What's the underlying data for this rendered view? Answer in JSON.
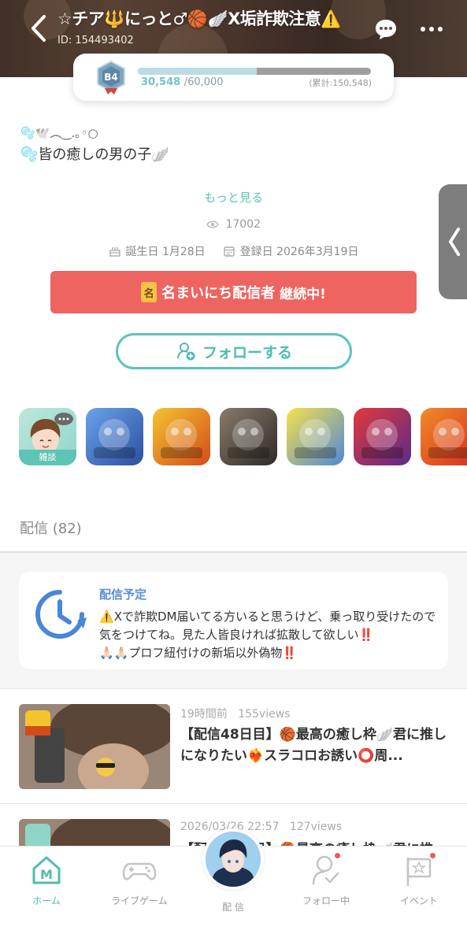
{
  "header": {
    "title": "☆チア🔱にっと♂🏀🪽X垢詐欺注意⚠️",
    "user_id": "ID: 154493402"
  },
  "level": {
    "badge": "B4",
    "current": "30,548",
    "max": "/60,000",
    "total": "(累計:150,548)",
    "progress": 0.509
  },
  "profile": {
    "bio_line1": "🫧🕊️︵‿.｡◦○",
    "bio_line2": "🫧皆の癒しの男の子🪽",
    "more_link": "もっと見る",
    "views": "17002",
    "birthday": "誕生日 1月28日",
    "registered": "登録日 2026年3月19日"
  },
  "streak": {
    "badge": "名",
    "main": "名まいにち配信者",
    "sub": "継続中!"
  },
  "follow_button": "フォローする",
  "games": [
    {
      "name": "chat",
      "label": "雑談",
      "colors": [
        "#bde7dc",
        "#8fd6c8"
      ]
    },
    {
      "name": "game-2",
      "label": "",
      "colors": [
        "#6aa3e8",
        "#2b4fa0"
      ]
    },
    {
      "name": "game-3",
      "label": "",
      "colors": [
        "#f4c430",
        "#d44b1b"
      ]
    },
    {
      "name": "game-4",
      "label": "",
      "colors": [
        "#8a7b6b",
        "#2e2a26"
      ]
    },
    {
      "name": "game-5",
      "label": "",
      "colors": [
        "#f7e14a",
        "#4f88d8"
      ]
    },
    {
      "name": "game-6",
      "label": "",
      "colors": [
        "#e23a3a",
        "#5b2a8a"
      ]
    },
    {
      "name": "game-7",
      "label": "",
      "colors": [
        "#f08a2a",
        "#d6301f"
      ]
    }
  ],
  "section": {
    "title": "配信 (82)"
  },
  "schedule": {
    "title": "配信予定",
    "line1_warn": "⚠️",
    "line1": "Xで詐欺DM届いてる方いると思うけど、乗っ取り受けたので気をつけてね。見た人皆良ければ拡散して欲しい",
    "line1_excl": "‼️",
    "line2_hands": "🙏🏻🙏🏻",
    "line2": "プロフ紐付けの新垢以外偽物",
    "line2_excl": "‼️"
  },
  "streams": [
    {
      "meta_time": "19時間前",
      "meta_views": "155views",
      "title": "【配信48日目】🏀最高の癒し枠🪽君に推しになりたい❤️‍🔥スラコロお誘い⭕️周..."
    },
    {
      "meta_time": "2026/03/26 22:57",
      "meta_views": "127views",
      "title": "【配信47日目】🏀最高の癒し枠🪽君に推"
    }
  ],
  "nav": {
    "home": "ホーム",
    "live_game": "ライブゲーム",
    "broadcast": "配 信",
    "following": "フォロー中",
    "event": "イベント"
  },
  "colors": {
    "accent": "#5cc4b9",
    "streak": "#ee6460",
    "schedule_title": "#5b8fd6",
    "notification": "#ee5b5b"
  }
}
